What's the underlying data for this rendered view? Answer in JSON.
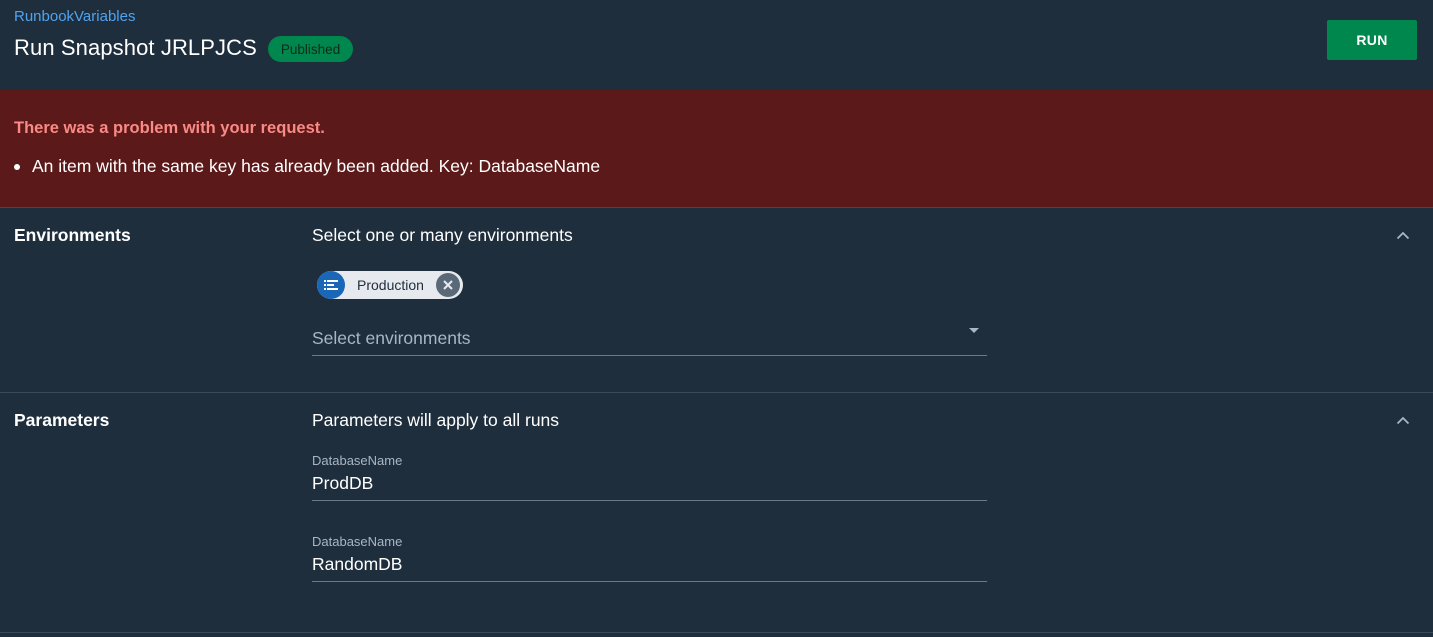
{
  "header": {
    "breadcrumb": "RunbookVariables",
    "title": "Run Snapshot JRLPJCS",
    "status": "Published",
    "run_label": "RUN"
  },
  "error": {
    "title": "There was a problem with your request.",
    "items": [
      "An item with the same key has already been added. Key: DatabaseName"
    ]
  },
  "environments": {
    "label": "Environments",
    "help": "Select one or many environments",
    "selected": [
      {
        "label": "Production",
        "icon": "environment-icon"
      }
    ],
    "placeholder": "Select environments"
  },
  "parameters": {
    "label": "Parameters",
    "help": "Parameters will apply to all runs",
    "fields": [
      {
        "label": "DatabaseName",
        "value": "ProdDB"
      },
      {
        "label": "DatabaseName",
        "value": "RandomDB"
      }
    ]
  },
  "colors": {
    "background": "#1f2e3d",
    "accent_green": "#00874d",
    "link_blue": "#4fa3f0",
    "error_bg": "#5c1919",
    "error_text": "#f98a86",
    "chip_avatar": "#1a67b8"
  }
}
